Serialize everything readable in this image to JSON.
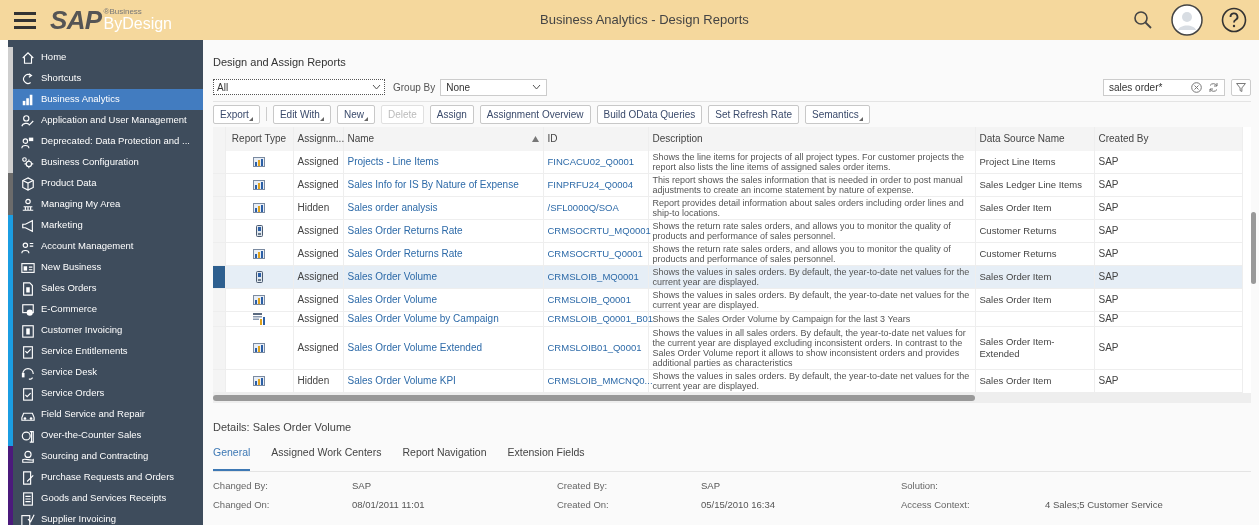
{
  "header": {
    "logo": {
      "brand": "SAP",
      "line1": "®Business",
      "line2": "ByDesign"
    },
    "title": "Business Analytics - Design Reports"
  },
  "sidebar": {
    "items": [
      {
        "label": "Home",
        "selected": false,
        "color": "#cfcfcf"
      },
      {
        "label": "Shortcuts",
        "selected": false,
        "color": "#cfcfcf"
      },
      {
        "label": "Business Analytics",
        "selected": true,
        "color": "#cfcfcf"
      },
      {
        "label": "Application and User Management",
        "selected": false,
        "color": "#cfcfcf"
      },
      {
        "label": "Deprecated: Data Protection and ...",
        "selected": false,
        "color": "#cfcfcf"
      },
      {
        "label": "Business Configuration",
        "selected": false,
        "color": "#cfcfcf"
      },
      {
        "label": "Product Data",
        "selected": false,
        "color": "#6b6b6b"
      },
      {
        "label": "Managing My Area",
        "selected": false,
        "color": "#6b6b6b"
      },
      {
        "label": "Marketing",
        "selected": false,
        "color": "#1b9de2"
      },
      {
        "label": "Account Management",
        "selected": false,
        "color": "#1b9de2"
      },
      {
        "label": "New Business",
        "selected": false,
        "color": "#1b9de2"
      },
      {
        "label": "Sales Orders",
        "selected": false,
        "color": "#1b9de2"
      },
      {
        "label": "E-Commerce",
        "selected": false,
        "color": "#1b9de2"
      },
      {
        "label": "Customer Invoicing",
        "selected": false,
        "color": "#1b9de2"
      },
      {
        "label": "Service Entitlements",
        "selected": false,
        "color": "#1b9de2"
      },
      {
        "label": "Service Desk",
        "selected": false,
        "color": "#1b9de2"
      },
      {
        "label": "Service Orders",
        "selected": false,
        "color": "#1b9de2"
      },
      {
        "label": "Field Service and Repair",
        "selected": false,
        "color": "#1b9de2"
      },
      {
        "label": "Over-the-Counter Sales",
        "selected": false,
        "color": "#1b9de2"
      },
      {
        "label": "Sourcing and Contracting",
        "selected": false,
        "color": "#4b1a7c"
      },
      {
        "label": "Purchase Requests and Orders",
        "selected": false,
        "color": "#4b1a7c"
      },
      {
        "label": "Goods and Services Receipts",
        "selected": false,
        "color": "#4b1a7c"
      },
      {
        "label": "Supplier Invoicing",
        "selected": false,
        "color": "#4b1a7c"
      }
    ]
  },
  "page_title": "Design and Assign Reports",
  "filter": {
    "value": "All",
    "group_by_label": "Group By",
    "group_by_value": "None"
  },
  "search": {
    "value": "sales order*"
  },
  "toolbar": [
    {
      "kind": "button",
      "label": "Export",
      "menu": true,
      "disabled": false
    },
    {
      "kind": "separator"
    },
    {
      "kind": "button",
      "label": "Edit With",
      "menu": true,
      "disabled": false
    },
    {
      "kind": "button",
      "label": "New",
      "menu": true,
      "disabled": false
    },
    {
      "kind": "button",
      "label": "Delete",
      "menu": false,
      "disabled": true
    },
    {
      "kind": "button",
      "label": "Assign",
      "menu": false,
      "disabled": false
    },
    {
      "kind": "button",
      "label": "Assignment Overview",
      "menu": false,
      "disabled": false
    },
    {
      "kind": "button",
      "label": "Build OData Queries",
      "menu": false,
      "disabled": false
    },
    {
      "kind": "button",
      "label": "Set Refresh Rate",
      "menu": false,
      "disabled": false
    },
    {
      "kind": "button",
      "label": "Semantics",
      "menu": true,
      "disabled": false
    }
  ],
  "table": {
    "columns": [
      "Report Type",
      "Assignm...",
      "Name",
      "ID",
      "Description",
      "Data Source Name",
      "Created By"
    ],
    "rows": [
      {
        "kind": "chart",
        "selected": false,
        "assignment": "Assigned",
        "name": "Projects - Line Items",
        "id": "FINCACU02_Q0001",
        "description": "Shows the line items for projects of all project types. For customer projects the report also lists the line items of assigned sales order items.",
        "data_source": "Project Line Items",
        "created_by": "SAP"
      },
      {
        "kind": "chart",
        "selected": false,
        "assignment": "Assigned",
        "name": "Sales Info for IS By Nature of Expense",
        "id": "FINPRFU24_Q0004",
        "description": "This report shows the sales information that is needed in order to post manual adjustments to create an income statement by nature of expense.",
        "data_source": "Sales Ledger Line Items",
        "created_by": "SAP"
      },
      {
        "kind": "chart",
        "selected": false,
        "assignment": "Hidden",
        "name": "Sales order analysis",
        "id": "/SFL0000Q/SOA",
        "description": "Report provides detail information about sales orders including order lines and ship-to locations.",
        "data_source": "Sales Order Item",
        "created_by": "SAP"
      },
      {
        "kind": "kpi",
        "selected": false,
        "assignment": "Assigned",
        "name": "Sales Order Returns Rate",
        "id": "CRMSOCRTU_MQ0001",
        "description": "Shows the return rate sales orders, and allows you to monitor the quality of products and performance of sales personnel.",
        "data_source": "Customer Returns",
        "created_by": "SAP"
      },
      {
        "kind": "chart",
        "selected": false,
        "assignment": "Assigned",
        "name": "Sales Order Returns Rate",
        "id": "CRMSOCRTU_Q0001",
        "description": "Shows the return rate sales orders, and allows you to monitor the quality of products and performance of sales personnel.",
        "data_source": "Customer Returns",
        "created_by": "SAP"
      },
      {
        "kind": "kpi",
        "selected": true,
        "assignment": "Assigned",
        "name": "Sales Order Volume",
        "id": "CRMSLOIB_MQ0001",
        "description": "Shows the values in sales orders. By default, the year-to-date net values for the current year are displayed.",
        "data_source": "Sales Order Item",
        "created_by": "SAP"
      },
      {
        "kind": "chart",
        "selected": false,
        "assignment": "Assigned",
        "name": "Sales Order Volume",
        "id": "CRMSLOIB_Q0001",
        "description": "Shows the values in sales orders. By default, the year-to-date net values for the current year are displayed.",
        "data_source": "Sales Order Item",
        "created_by": "SAP"
      },
      {
        "kind": "combined",
        "selected": false,
        "assignment": "Assigned",
        "name": "Sales Order Volume by Campaign",
        "id": "CRMSLOIB_Q0001_B01",
        "description": "Shows the Sales Order Volume by Campaign for the last 3 Years",
        "created_by": "SAP"
      },
      {
        "kind": "chart",
        "selected": false,
        "assignment": "Assigned",
        "name": "Sales Order Volume Extended",
        "id": "CRMSLOIB01_Q0001",
        "description": "Shows the values in all sales orders. By default, the year-to-date net values for the current year are displayed excluding inconsistent orders. In contrast to the Sales Order Volume report it allows to show inconsistent orders and provides additional parties as characteristics",
        "data_source": "Sales Order Item-Extended",
        "created_by": "SAP"
      },
      {
        "kind": "chart",
        "selected": false,
        "assignment": "Hidden",
        "name": "Sales Order Volume KPI",
        "id": "CRMSLOIB_MMCNQ0...",
        "description": "Shows the values in sales orders. By default, the year-to-date net values for the current year are displayed.",
        "data_source": "Sales Order Item",
        "created_by": "SAP"
      }
    ]
  },
  "details": {
    "title": "Details: Sales Order Volume",
    "tabs": [
      {
        "label": "General",
        "selected": true
      },
      {
        "label": "Assigned Work Centers",
        "selected": false
      },
      {
        "label": "Report Navigation",
        "selected": false
      },
      {
        "label": "Extension Fields",
        "selected": false
      }
    ],
    "fields": [
      {
        "label": "Changed By:",
        "value": "SAP"
      },
      {
        "label": "Created By:",
        "value": "SAP"
      },
      {
        "label": "Solution:"
      },
      {
        "label": "Changed On:",
        "value": "08/01/2011 11:01"
      },
      {
        "label": "Created On:",
        "value": "05/15/2010 16:34"
      },
      {
        "label": "Access Context:",
        "value": "4 Sales;5 Customer Service"
      }
    ]
  }
}
